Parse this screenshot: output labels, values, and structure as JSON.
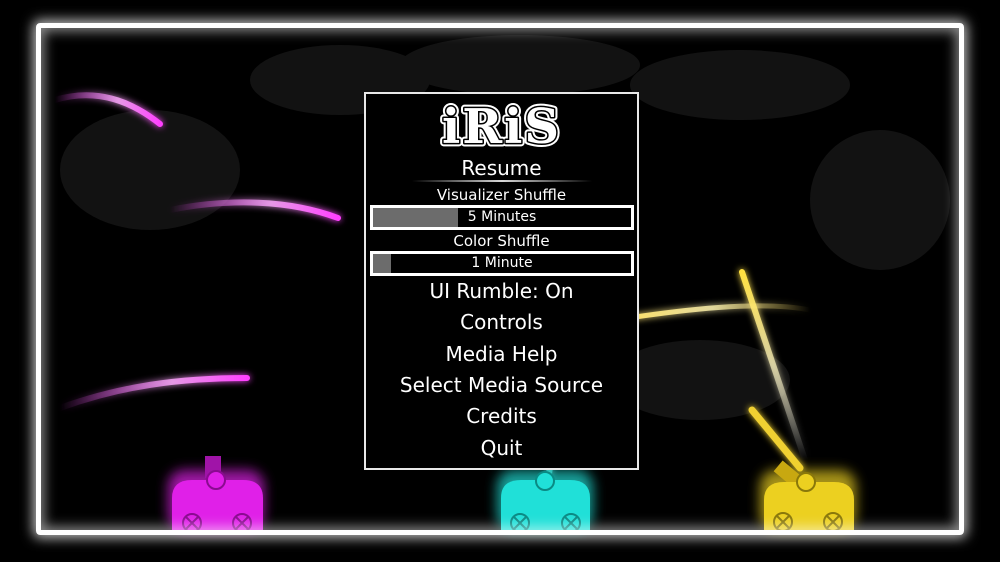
{
  "game": {
    "logo_text": "iRiS"
  },
  "menu": {
    "resume_label": "Resume",
    "visualizer_shuffle": {
      "label": "Visualizer Shuffle",
      "value": "5 Minutes",
      "fill_fraction": 0.33
    },
    "color_shuffle": {
      "label": "Color Shuffle",
      "value": "1 Minute",
      "fill_fraction": 0.07
    },
    "items": [
      {
        "label": "UI Rumble: On"
      },
      {
        "label": "Controls"
      },
      {
        "label": "Media Help"
      },
      {
        "label": "Select Media Source"
      },
      {
        "label": "Credits"
      },
      {
        "label": "Quit"
      }
    ]
  },
  "colors": {
    "magenta": "#e020e8",
    "cyan": "#20e0d8",
    "yellow": "#ecd020",
    "slider_fill": "#6c6c6c"
  }
}
